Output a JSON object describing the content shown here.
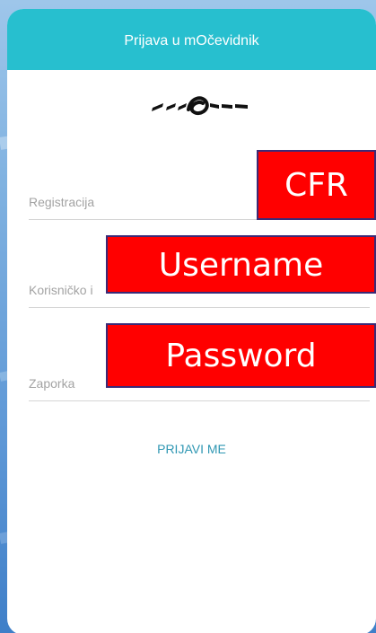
{
  "header": {
    "title": "Prijava u mOčevidnik"
  },
  "logo": {
    "name": "knot-logo-icon"
  },
  "fields": {
    "registration": {
      "placeholder": "Registracija",
      "value": ""
    },
    "username": {
      "placeholder": "Korisničko i",
      "value": ""
    },
    "password": {
      "placeholder": "Zaporka",
      "value": ""
    }
  },
  "submit_label": "PRIJAVI ME",
  "annotations": {
    "cfr": "CFR",
    "username": "Username",
    "password": "Password"
  },
  "colors": {
    "header": "#27bfcf",
    "accent": "#2f97b3",
    "annotation": "#ff0000",
    "annotation_border": "#3b2a76"
  }
}
